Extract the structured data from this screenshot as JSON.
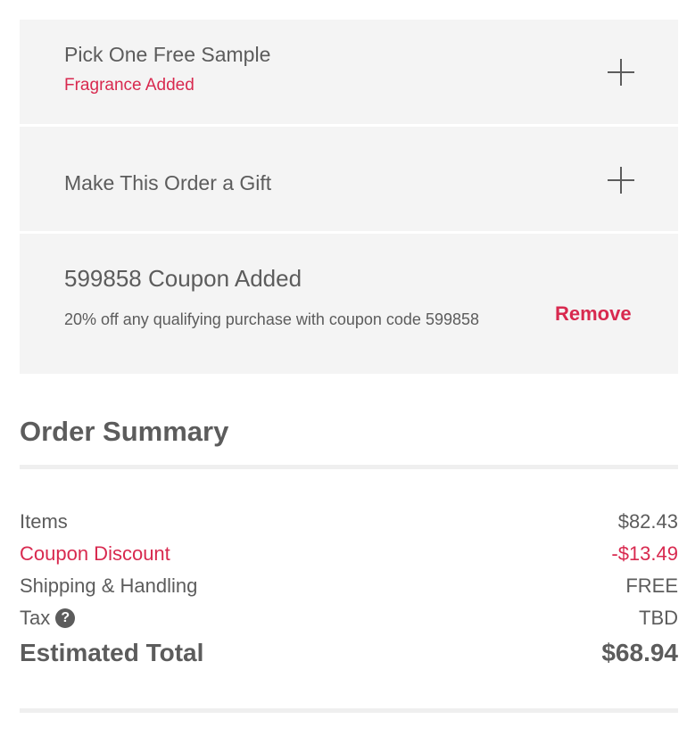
{
  "sample": {
    "title": "Pick One Free Sample",
    "status": "Fragrance Added",
    "expand_icon": "plus-icon"
  },
  "gift": {
    "title": "Make This Order a Gift",
    "expand_icon": "plus-icon"
  },
  "coupon": {
    "title": "599858 Coupon Added",
    "description": "20% off any qualifying purchase with coupon code 599858",
    "remove_label": "Remove"
  },
  "summary": {
    "title": "Order Summary",
    "rows": [
      {
        "label": "Items",
        "value": "$82.43"
      },
      {
        "label": "Coupon Discount",
        "value": "-$13.49"
      },
      {
        "label": "Shipping & Handling",
        "value": "FREE"
      },
      {
        "label": "Tax",
        "value": "TBD"
      },
      {
        "label": "Estimated Total",
        "value": "$68.94"
      }
    ],
    "help_icon_glyph": "?"
  },
  "colors": {
    "accent": "#d8294f",
    "text": "#5c5c5c",
    "panel_bg": "#f4f4f4"
  }
}
